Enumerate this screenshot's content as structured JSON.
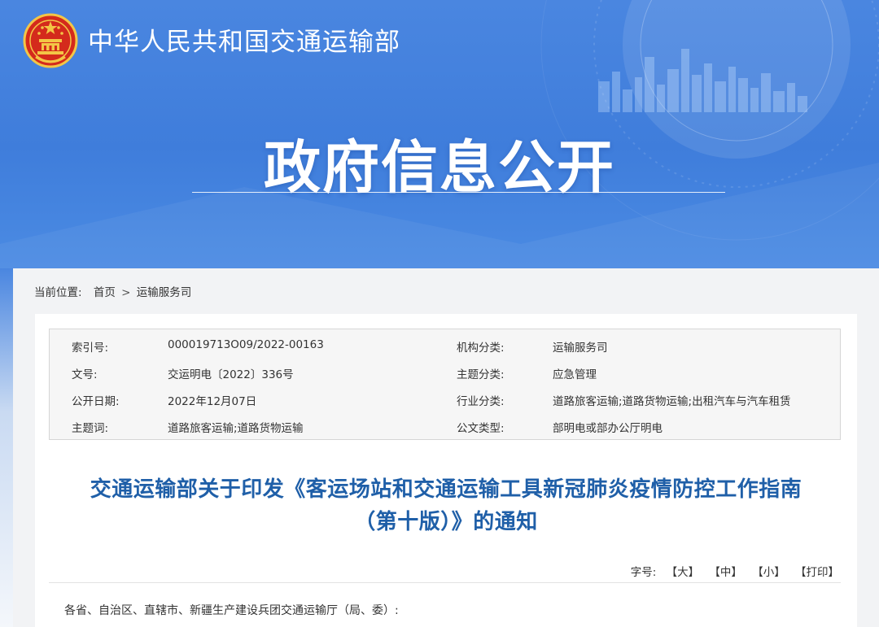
{
  "header": {
    "site_name": "中华人民共和国交通运输部",
    "banner_title": "政府信息公开"
  },
  "breadcrumb": {
    "prefix": "当前位置:",
    "home": "首页",
    "separator": ">",
    "current": "运输服务司"
  },
  "meta": [
    {
      "label": "索引号:",
      "value": "000019713O09/2022-00163",
      "label2": "机构分类:",
      "value2": "运输服务司"
    },
    {
      "label": "文号:",
      "value": "交运明电〔2022〕336号",
      "label2": "主题分类:",
      "value2": "应急管理"
    },
    {
      "label": "公开日期:",
      "value": "2022年12月07日",
      "label2": "行业分类:",
      "value2": "道路旅客运输;道路货物运输;出租汽车与汽车租赁"
    },
    {
      "label": "主题词:",
      "value": "道路旅客运输;道路货物运输",
      "label2": "公文类型:",
      "value2": "部明电或部办公厅明电"
    }
  ],
  "article": {
    "title_line1": "交通运输部关于印发《客运场站和交通运输工具新冠肺炎疫情防控工作指南",
    "title_line2": "（第十版）》的通知",
    "salutation": "各省、自治区、直辖市、新疆生产建设兵团交通运输厅（局、委）:"
  },
  "font_size": {
    "label": "字号:",
    "large": "【大】",
    "medium": "【中】",
    "small": "【小】",
    "print": "【打印】"
  },
  "colors": {
    "banner_blue": "#4a86e0",
    "title_blue": "#1f5fa8",
    "emblem_red": "#d42a1c",
    "emblem_gold": "#f3c646"
  }
}
